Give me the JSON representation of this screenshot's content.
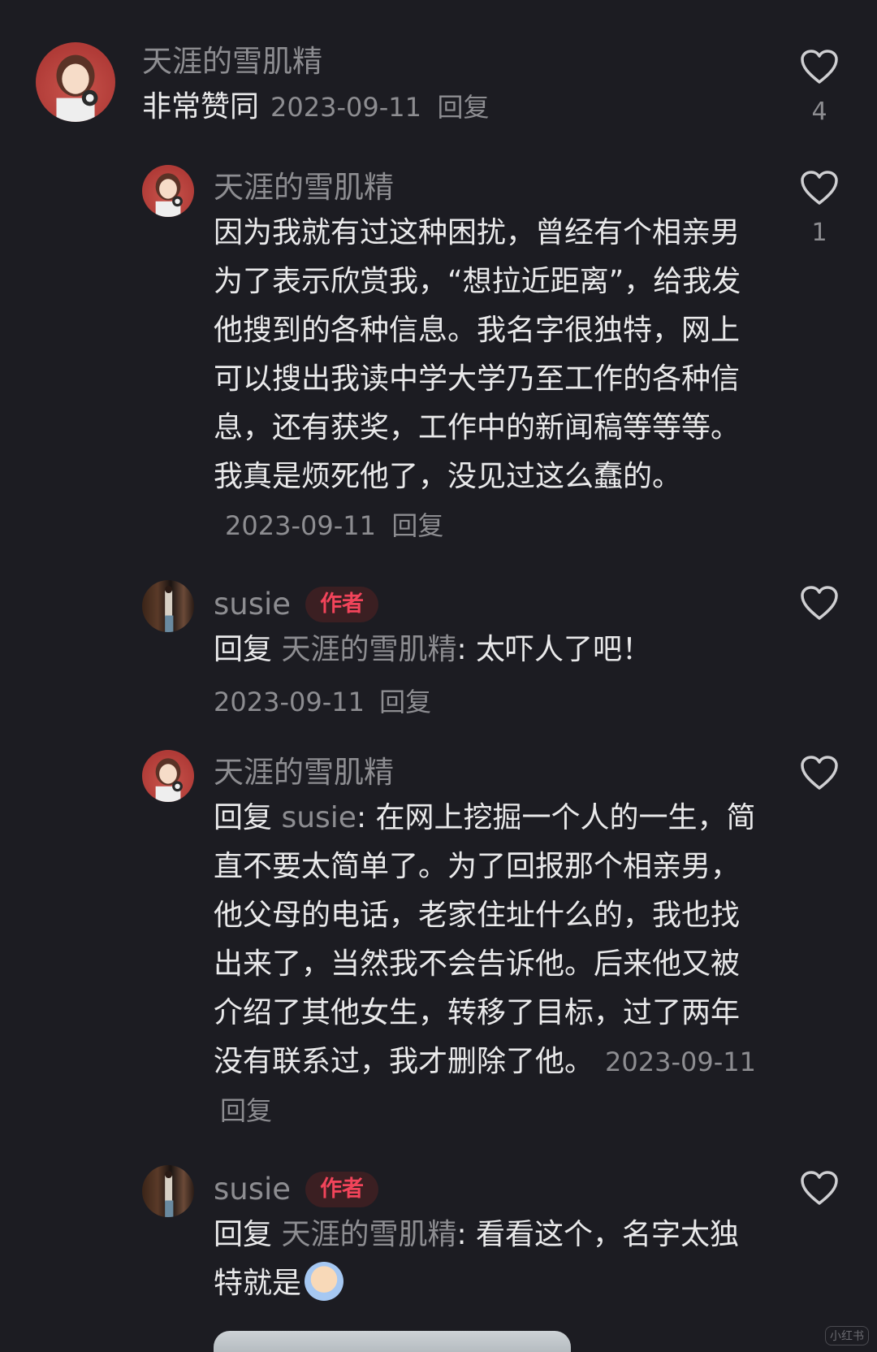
{
  "comments": [
    {
      "author": "天涯的雪肌精",
      "text": "非常赞同",
      "date": "2023-09-11",
      "reply_label": "回复",
      "likes": "4"
    },
    {
      "author": "天涯的雪肌精",
      "text": "因为我就有过这种困扰，曾经有个相亲男为了表示欣赏我，“想拉近距离”，给我发他搜到的各种信息。我名字很独特，网上可以搜出我读中学大学乃至工作的各种信息，还有获奖，工作中的新闻稿等等等。我真是烦死他了，没见过这么蠢的。",
      "date": "2023-09-11",
      "reply_label": "回复",
      "likes": "1"
    },
    {
      "author": "susie",
      "badge": "作者",
      "reply_prefix": "回复",
      "reply_to": "天涯的雪肌精",
      "text": ": 太吓人了吧！",
      "date": "2023-09-11",
      "reply_label": "回复"
    },
    {
      "author": "天涯的雪肌精",
      "reply_prefix": "回复",
      "reply_to": "susie",
      "text": ": 在网上挖掘一个人的一生，简直不要太简单了。为了回报那个相亲男，他父母的电话，老家住址什么的，我也找出来了，当然我不会告诉他。后来他又被介绍了其他女生，转移了目标，过了两年没有联系过，我才删除了他。",
      "date": "2023-09-11",
      "reply_label": "回复"
    },
    {
      "author": "susie",
      "badge": "作者",
      "reply_prefix": "回复",
      "reply_to": "天涯的雪肌精",
      "text": ": 看看这个，名字太独特就是",
      "emoji": "crying-face-emoji"
    }
  ],
  "watermark": "小红书",
  "colors": {
    "background": "#1c1c22",
    "text": "#e9e9ea",
    "muted": "#8d8d91",
    "badge_text": "#f2445a",
    "badge_bg": "#3b1f22"
  }
}
